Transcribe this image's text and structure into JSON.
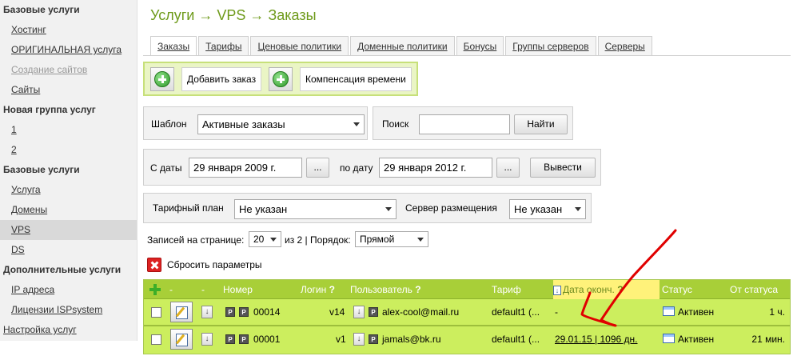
{
  "sidebar": {
    "g1": "Базовые услуги",
    "g1_items": [
      "Хостинг",
      "ОРИГИНАЛЬНАЯ услуга",
      "Создание сайтов",
      "Сайты"
    ],
    "g2": "Новая группа услуг",
    "g2_items": [
      "1",
      "2"
    ],
    "g3": "Базовые услуги",
    "g3_items": [
      "Услуга",
      "Домены",
      "VPS",
      "DS"
    ],
    "g4": "Дополнительные услуги",
    "g4_items": [
      "IP адреса",
      "Лицензии ISPsystem"
    ],
    "settings": "Настройка услуг"
  },
  "page_title": "Услуги → VPS → Заказы",
  "tabs": [
    "Заказы",
    "Тарифы",
    "Ценовые политики",
    "Доменные политики",
    "Бонусы",
    "Группы серверов",
    "Серверы"
  ],
  "actions": {
    "add_order": "Добавить заказ",
    "time_compensation": "Компенсация времени"
  },
  "filters": {
    "template_label": "Шаблон",
    "template_value": "Активные заказы",
    "search_label": "Поиск",
    "search_value": "",
    "find_button": "Найти",
    "from_date_label": "С даты",
    "from_date_value": "29 января 2009 г.",
    "to_date_label": "по дату",
    "to_date_value": "29 января 2012 г.",
    "ellipsis": "...",
    "output_button": "Вывести",
    "tariff_label": "Тарифный план",
    "tariff_value": "Не указан",
    "server_label": "Сервер размещения",
    "server_value": "Не указан"
  },
  "paging": {
    "per_page_label": "Записей на странице:",
    "per_page_value": "20",
    "of_pages": "из 2 | Порядок:",
    "order_value": "Прямой"
  },
  "reset_label": "Сбросить параметры",
  "table": {
    "headers": {
      "dash1": "-",
      "dash2": "-",
      "number": "Номер",
      "login": "Логин",
      "user": "Пользователь",
      "tariff": "Тариф",
      "end_date": "Дата оконч.",
      "status": "Статус",
      "from_status": "От статуса",
      "q": "?"
    },
    "rows": [
      {
        "number": "00014",
        "login": "v14",
        "user": "alex-cool@mail.ru",
        "tariff": "default1 (...",
        "end_date": "-",
        "status": "Активен",
        "from_status": "1 ч."
      },
      {
        "number": "00001",
        "login": "v1",
        "user": "jamals@bk.ru",
        "tariff": "default1 (...",
        "end_date": "29.01.15 | 1096 дн.",
        "status": "Активен",
        "from_status": "21 мин."
      }
    ]
  },
  "colors": {
    "accent_green": "#a8cf38",
    "row_green": "#ccee5e",
    "title_green": "#6e9a1a",
    "annotation_red": "#e00000"
  }
}
